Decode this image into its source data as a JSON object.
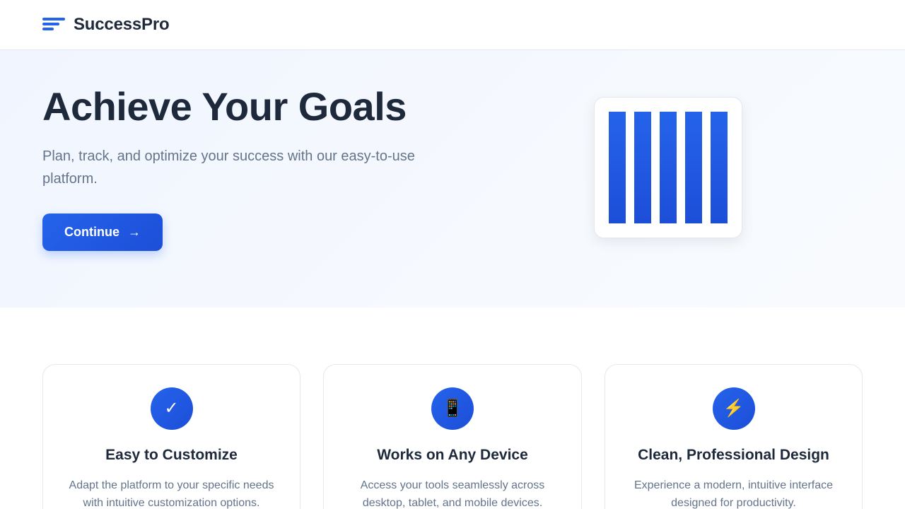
{
  "header": {
    "logo_icon": "stacked-lines-logo-icon",
    "brand": "SuccessPro"
  },
  "hero": {
    "title": "Achieve Your Goals",
    "subtitle": "Plan, track, and optimize your success with our easy-to-use platform.",
    "cta_label": "Continue",
    "cta_icon": "→",
    "illustration": "bar-columns-illustration"
  },
  "features": [
    {
      "icon": "✓",
      "icon_name": "checkmark-icon",
      "title": "Easy to Customize",
      "description": "Adapt the platform to your specific needs with intuitive customization options."
    },
    {
      "icon": "📱",
      "icon_name": "mobile-phone-icon",
      "title": "Works on Any Device",
      "description": "Access your tools seamlessly across desktop, tablet, and mobile devices."
    },
    {
      "icon": "⚡",
      "icon_name": "lightning-icon",
      "title": "Clean, Professional Design",
      "description": "Experience a modern, intuitive interface designed for productivity."
    }
  ],
  "colors": {
    "accent": "#2563eb",
    "accent_dark": "#1d4ed8",
    "text_primary": "#1e293b",
    "text_muted": "#64748b",
    "hero_bg": "#f0f5ff",
    "border": "#e2e8f0"
  }
}
